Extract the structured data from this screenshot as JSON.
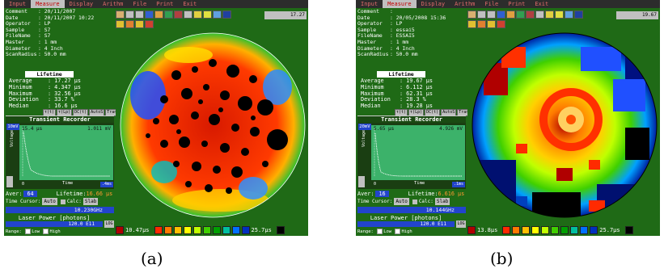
{
  "menu": [
    "Input",
    "Measure",
    "Display",
    "Arithm",
    "File",
    "Print",
    "Exit"
  ],
  "menu_active": "Measure",
  "colors": {
    "panel_green": "#1f6a16",
    "menu_bg": "#2c2c2c",
    "highlight_blue": "#2244cc",
    "plot_green": "#3cb26a",
    "scale": [
      "#b00000",
      "#ff2a00",
      "#ff7a00",
      "#ffc000",
      "#ffff00",
      "#c0ff00",
      "#40d000",
      "#00a000",
      "#00c0a0",
      "#0070ff",
      "#0030c0",
      "#001070"
    ]
  },
  "panels": [
    {
      "id": "a",
      "caption": "(a)",
      "info": [
        {
          "k": "Comment",
          "v": ": 20/11/2007"
        },
        {
          "k": "Date",
          "v": ": 20/11/2007 10:22"
        },
        {
          "k": "Operator",
          "v": ": LP"
        },
        {
          "k": "Sample",
          "v": ": S7"
        },
        {
          "k": "FileName",
          "v": ": S7"
        },
        {
          "k": "Master",
          "v": ": 1 mm"
        },
        {
          "k": "Diameter",
          "v": ": 4 Inch"
        },
        {
          "k": "ScanRadius",
          "v": ": 50.0  mm"
        }
      ],
      "lifetime_title": "Lifetime",
      "lifetime": [
        {
          "k": "Average",
          "v": ": 17.27 µs"
        },
        {
          "k": "Minimum",
          "v": ": 4.347 µs"
        },
        {
          "k": "Maximum",
          "v": ": 32.56 µs"
        },
        {
          "k": "Deviation",
          "v": ": 33.7 %"
        },
        {
          "k": "Median",
          "v": ": 16.6 µs"
        }
      ],
      "mode_buttons": [
        "τ(t)",
        "τ(Lp)",
        "DC(t)",
        "AutoS",
        "Trans"
      ],
      "transient_title": "Transient Recorder",
      "transient": {
        "scale": "10mV",
        "t1": "15.4 µs",
        "t2": "1.011 mV",
        "ylabel": "Voltage",
        "xlabel": "Time",
        "zero": "0",
        "range": ".4ms"
      },
      "aver_label": "Aver:",
      "aver_n": "64",
      "lifetime_label": "Lifetime:",
      "lifetime_val": "16.66 µs",
      "cursor_label": "Time Cursor:",
      "cursor_mode": "Auto",
      "calc_label": "Calc:",
      "calc_mode": "Slab",
      "freq": "10.230GHz",
      "laser_title": "Laser Power [photons]",
      "laser_val": "120.0 E11",
      "laser_btn": "LOG",
      "range_label": "Range:",
      "range_low": "Low",
      "range_high": "High",
      "readout": "17.27",
      "legend_min": "10.47µs",
      "legend_max": "25.7µs"
    },
    {
      "id": "b",
      "caption": "(b)",
      "info": [
        {
          "k": "Comment",
          "v": ":"
        },
        {
          "k": "Date",
          "v": ": 20/05/2008 15:36"
        },
        {
          "k": "Operator",
          "v": ": LP"
        },
        {
          "k": "Sample",
          "v": ": essai5"
        },
        {
          "k": "FileName",
          "v": ": ESSAI5"
        },
        {
          "k": "Master",
          "v": ": 1 mm"
        },
        {
          "k": "Diameter",
          "v": ": 4 Inch"
        },
        {
          "k": "ScanRadius",
          "v": ": 50.0  mm"
        }
      ],
      "lifetime_title": "Lifetime",
      "lifetime": [
        {
          "k": "Average",
          "v": ": 19.67 µs"
        },
        {
          "k": "Minimum",
          "v": ": 6.112 µs"
        },
        {
          "k": "Maximum",
          "v": ": 62.31 µs"
        },
        {
          "k": "Deviation",
          "v": ": 28.3 %"
        },
        {
          "k": "Median",
          "v": ": 19.28 µs"
        }
      ],
      "mode_buttons": [
        "τ(t)",
        "τ(Lp)",
        "DC(t)",
        "AutoS",
        "Trans"
      ],
      "transient_title": "Transient Recorder",
      "transient": {
        "scale": "20mV",
        "t1": "5.65 µs",
        "t2": "4.926 mV",
        "ylabel": "Voltage",
        "xlabel": "Time",
        "zero": "0",
        "range": ".1ms"
      },
      "aver_label": "Aver:",
      "aver_n": "16",
      "lifetime_label": "Lifetime:",
      "lifetime_val": "6.616 µs",
      "cursor_label": "Time Cursor:",
      "cursor_mode": "Auto",
      "calc_label": "Calc:",
      "calc_mode": "Slab",
      "freq": "10.144GHz",
      "laser_title": "Laser Power [photons]",
      "laser_val": "120.0 E11",
      "laser_btn": "LOG",
      "range_label": "Range:",
      "range_low": "Low",
      "range_high": "High",
      "readout": "19.67",
      "legend_min": "13.8µs",
      "legend_max": "25.7µs"
    }
  ]
}
